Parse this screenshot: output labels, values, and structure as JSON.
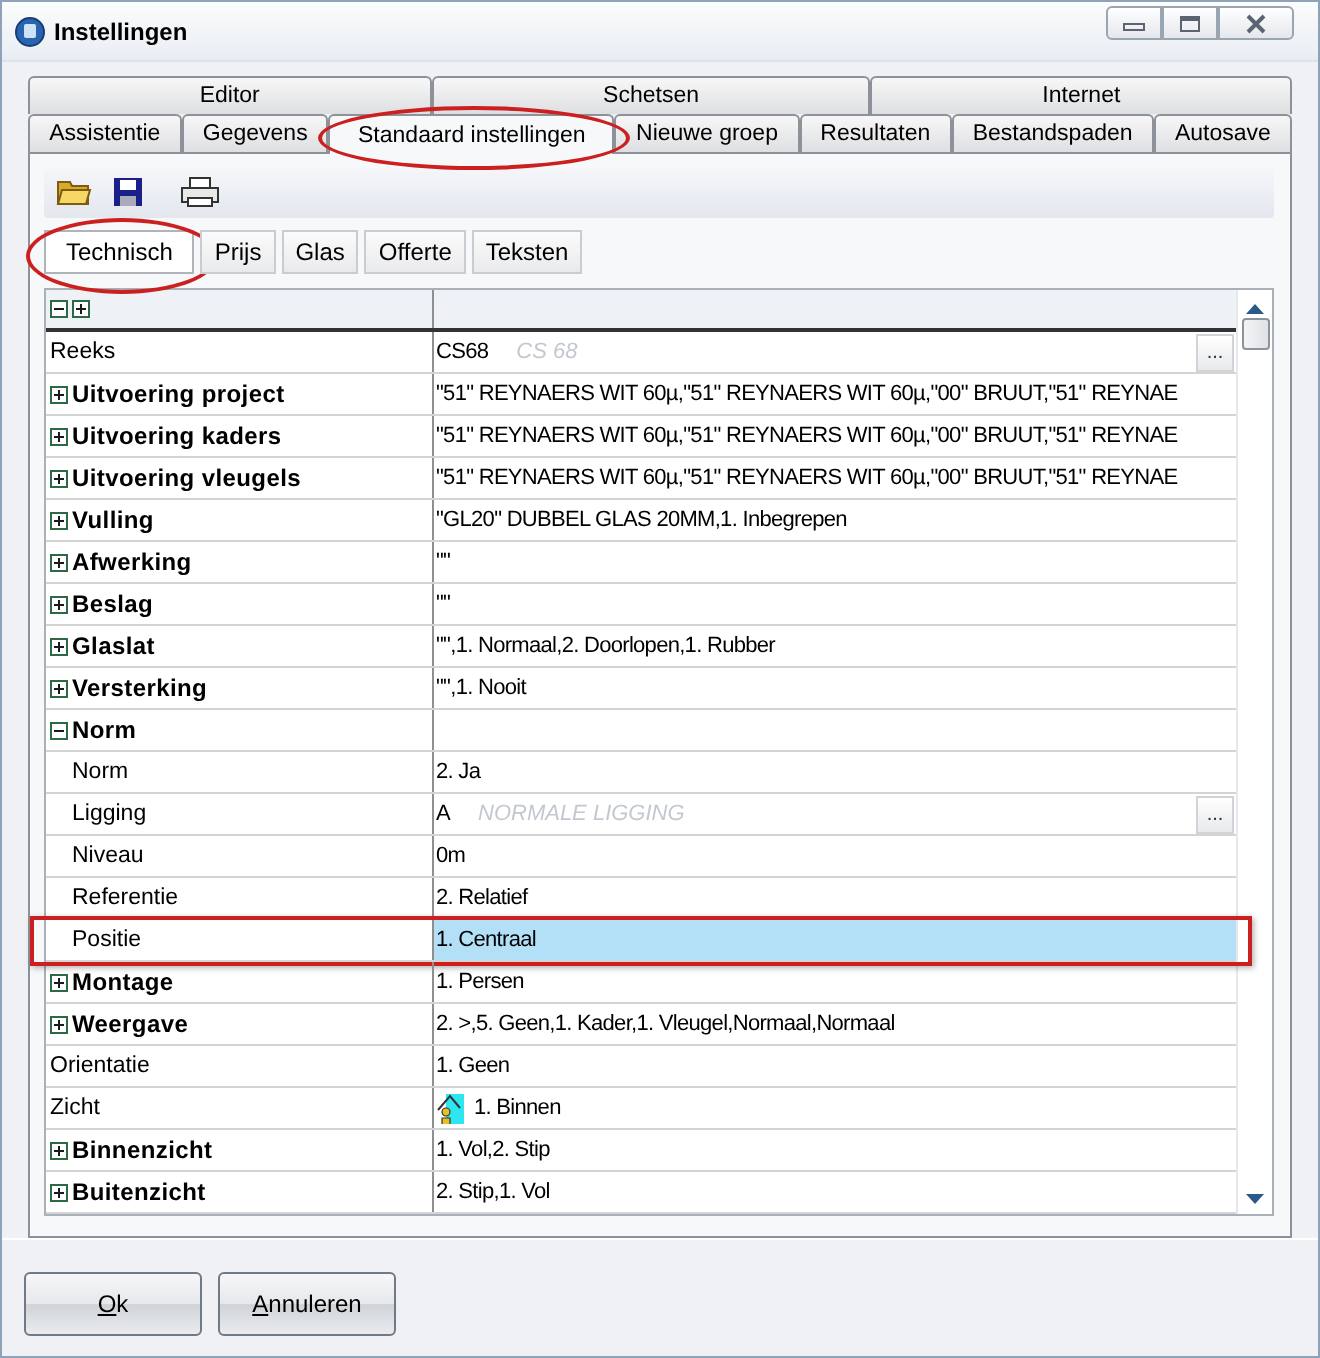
{
  "window": {
    "title": "Instellingen"
  },
  "tabs_top": [
    {
      "label": "Editor",
      "selected": false,
      "circled": false
    },
    {
      "label": "Schetsen",
      "selected": false,
      "circled": false
    },
    {
      "label": "Internet",
      "selected": false,
      "circled": false
    }
  ],
  "tabs_bottom": [
    {
      "label": "Assistentie",
      "selected": false,
      "circled": false
    },
    {
      "label": "Gegevens",
      "selected": false,
      "circled": false
    },
    {
      "label": "Standaard instellingen",
      "selected": true,
      "circled": true
    },
    {
      "label": "Nieuwe groep",
      "selected": false,
      "circled": false
    },
    {
      "label": "Resultaten",
      "selected": false,
      "circled": false
    },
    {
      "label": "Bestandspaden",
      "selected": false,
      "circled": false
    },
    {
      "label": "Autosave",
      "selected": false,
      "circled": false
    }
  ],
  "subtabs": [
    {
      "label": "Technisch",
      "selected": true,
      "circled": true
    },
    {
      "label": "Prijs",
      "selected": false,
      "circled": false
    },
    {
      "label": "Glas",
      "selected": false,
      "circled": false
    },
    {
      "label": "Offerte",
      "selected": false,
      "circled": false
    },
    {
      "label": "Teksten",
      "selected": false,
      "circled": false
    }
  ],
  "grid": {
    "rows": [
      {
        "kind": "property",
        "label": "Reeks",
        "value": "CS68",
        "hint": "CS 68",
        "button": "...",
        "selected": false
      },
      {
        "kind": "group",
        "label": "Uitvoering project",
        "expanded": false,
        "value": "\"51\" REYNAERS WIT 60µ,\"51\" REYNAERS WIT 60µ,\"00\" BRUUT,\"51\" REYNAE",
        "selected": false
      },
      {
        "kind": "group",
        "label": "Uitvoering kaders",
        "expanded": false,
        "value": "\"51\" REYNAERS WIT 60µ,\"51\" REYNAERS WIT 60µ,\"00\" BRUUT,\"51\" REYNAE",
        "selected": false
      },
      {
        "kind": "group",
        "label": "Uitvoering vleugels",
        "expanded": false,
        "value": "\"51\" REYNAERS WIT 60µ,\"51\" REYNAERS WIT 60µ,\"00\" BRUUT,\"51\" REYNAE",
        "selected": false
      },
      {
        "kind": "group",
        "label": "Vulling",
        "expanded": false,
        "value": "\"GL20\" DUBBEL GLAS 20MM,1. Inbegrepen",
        "selected": false
      },
      {
        "kind": "group",
        "label": "Afwerking",
        "expanded": false,
        "value": "\"\"",
        "selected": false
      },
      {
        "kind": "group",
        "label": "Beslag",
        "expanded": false,
        "value": "\"\"",
        "selected": false
      },
      {
        "kind": "group",
        "label": "Glaslat",
        "expanded": false,
        "value": "\"\",1. Normaal,2. Doorlopen,1. Rubber",
        "selected": false
      },
      {
        "kind": "group",
        "label": "Versterking",
        "expanded": false,
        "value": "\"\",1. Nooit",
        "selected": false
      },
      {
        "kind": "group",
        "label": "Norm",
        "expanded": true,
        "selected": false,
        "children": [
          {
            "kind": "property",
            "label": "Norm",
            "value": "2. Ja",
            "selected": false
          },
          {
            "kind": "property",
            "label": "Ligging",
            "value": "A",
            "hint": "NORMALE LIGGING",
            "button": "...",
            "selected": false
          },
          {
            "kind": "property",
            "label": "Niveau",
            "value": "0m",
            "selected": false
          },
          {
            "kind": "property",
            "label": "Referentie",
            "value": "2. Relatief",
            "selected": false
          },
          {
            "kind": "property",
            "label": "Positie",
            "value": "1. Centraal",
            "selected": true,
            "outlined": true
          }
        ]
      },
      {
        "kind": "group",
        "label": "Montage",
        "expanded": false,
        "value": "1. Persen",
        "selected": false
      },
      {
        "kind": "group",
        "label": "Weergave",
        "expanded": false,
        "value": "2. >,5. Geen,1. Kader,1. Vleugel,Normaal,Normaal",
        "selected": false
      },
      {
        "kind": "property",
        "label": "Orientatie",
        "value": "1. Geen",
        "selected": false
      },
      {
        "kind": "property",
        "label": "Zicht",
        "value": "1. Binnen",
        "value_icon": true,
        "selected": false
      },
      {
        "kind": "group",
        "label": "Binnenzicht",
        "expanded": false,
        "value": "1. Vol,2. Stip",
        "selected": false
      },
      {
        "kind": "group",
        "label": "Buitenzicht",
        "expanded": false,
        "value": "2. Stip,1. Vol",
        "selected": false
      }
    ]
  },
  "buttons": [
    {
      "label": "Ok",
      "underline_first": true
    },
    {
      "label": "Annuleren",
      "underline_first": true
    }
  ]
}
